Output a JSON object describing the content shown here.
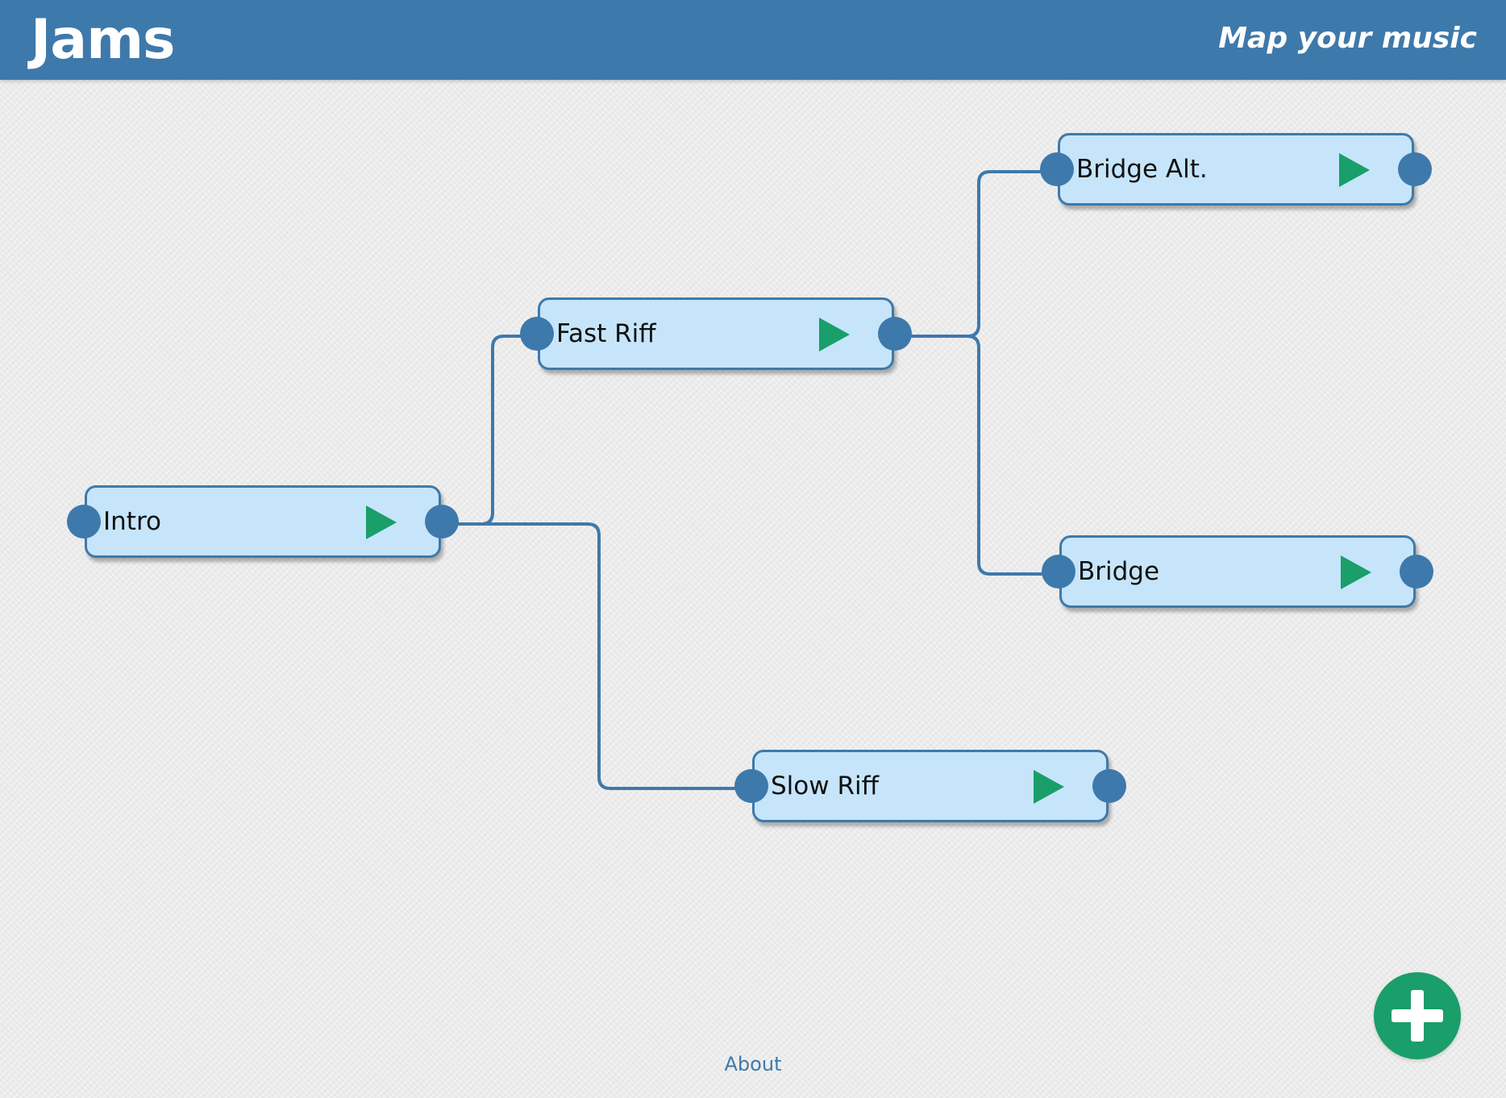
{
  "header": {
    "brand": "Jams",
    "tagline": "Map your music"
  },
  "nodes": [
    {
      "id": "intro",
      "label": "Intro"
    },
    {
      "id": "fast-riff",
      "label": "Fast Riff"
    },
    {
      "id": "slow-riff",
      "label": "Slow Riff"
    },
    {
      "id": "bridge-alt",
      "label": "Bridge Alt."
    },
    {
      "id": "bridge",
      "label": "Bridge"
    }
  ],
  "connections": [
    {
      "from": "intro",
      "to": "fast-riff"
    },
    {
      "from": "intro",
      "to": "slow-riff"
    },
    {
      "from": "fast-riff",
      "to": "bridge-alt"
    },
    {
      "from": "fast-riff",
      "to": "bridge"
    }
  ],
  "footer": {
    "about_label": "About"
  },
  "icons": {
    "play": "play-icon",
    "port": "connector-port-icon",
    "add": "plus-icon"
  },
  "colors": {
    "header_bg": "#3e79ab",
    "node_bg": "#c6e5fb",
    "node_border": "#3e79ab",
    "play": "#1a9e6a",
    "add_button": "#1a9e6a",
    "link": "#3e79ab"
  }
}
